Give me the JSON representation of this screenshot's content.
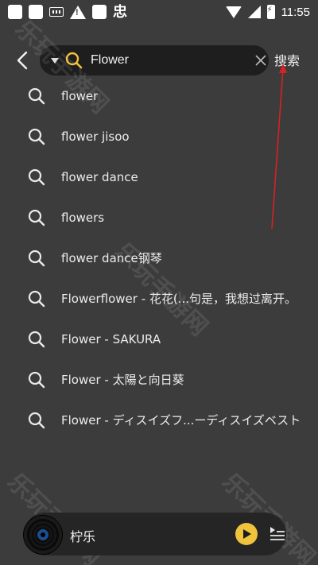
{
  "status_bar": {
    "glyph": "忠",
    "time": "11:55"
  },
  "search": {
    "query": "Flower",
    "action_label": "搜索"
  },
  "suggestions": [
    "flower",
    "flower jisoo",
    "flower dance",
    "flowers",
    "flower dance钢琴",
    "Flowerflower - 花花(...句是，我想过离开。",
    "Flower - SAKURA",
    "Flower - 太陽と向日葵",
    "Flower - ディスイズフ...ーディスイズベスト"
  ],
  "player": {
    "title": "柠乐"
  },
  "watermark": {
    "text": "乐玩手游网"
  },
  "colors": {
    "background": "#3c3c3c",
    "search_bg": "#1e1e1e",
    "accent": "#f0c33c",
    "annotation": "#d62222"
  },
  "icons": {
    "back": "chevron-left-icon",
    "search": "search-icon",
    "clear": "close-icon",
    "play": "play-icon",
    "playlist": "playlist-icon"
  }
}
